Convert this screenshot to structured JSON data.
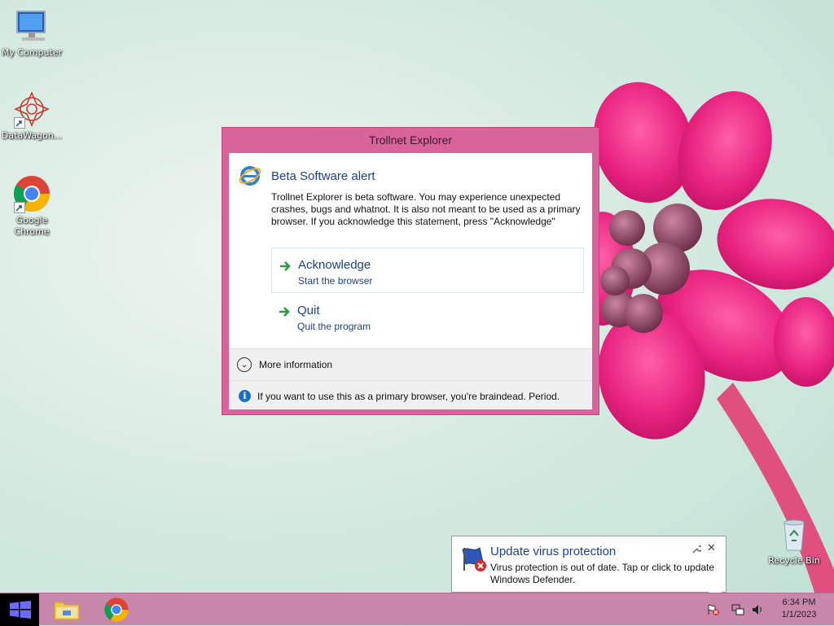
{
  "desktop": {
    "icons": [
      {
        "label": "My Computer",
        "icon": "computer-icon"
      },
      {
        "label": "DataWagon...",
        "icon": "datawagon-icon"
      },
      {
        "label": "Google Chrome",
        "icon": "chrome-icon"
      },
      {
        "label": "Recycle Bin",
        "icon": "recycle-bin-icon"
      }
    ]
  },
  "dialog": {
    "window_title": "Trollnet Explorer",
    "heading": "Beta Software alert",
    "message": "Trollnet Explorer is beta software. You may experience unexpected crashes, bugs and whatnot. It is also not meant to be used as a primary browser. If you acknowledge this statement, press \"Acknowledge\"",
    "options": [
      {
        "label": "Acknowledge",
        "sublabel": "Start the browser"
      },
      {
        "label": "Quit",
        "sublabel": "Quit the program"
      }
    ],
    "more_info_label": "More information",
    "footer_text": "If you want to use this as a primary browser, you're braindead. Period."
  },
  "notification": {
    "title": "Update virus protection",
    "message": "Virus protection is out of date. Tap or click to update Windows Defender.",
    "close_glyph": "✕"
  },
  "taskbar": {
    "pinned": [
      "file-explorer-icon",
      "chrome-icon"
    ],
    "tray": [
      "action-center-alert-icon",
      "network-icon",
      "volume-icon"
    ],
    "time": "6:34 PM",
    "date": "1/1/2023"
  },
  "colors": {
    "accent": "#d9649c",
    "taskbar": "#c986ab",
    "link_blue": "#1e3f8f"
  }
}
